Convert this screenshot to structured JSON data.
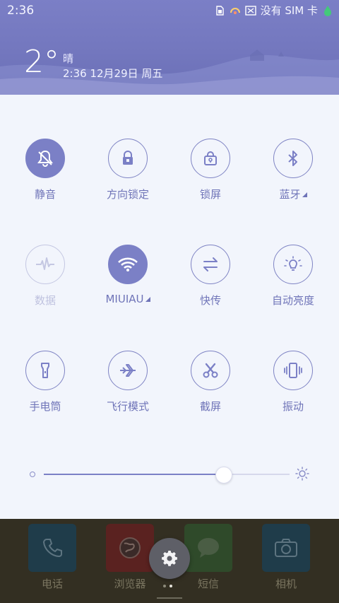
{
  "status_bar": {
    "time": "2:36",
    "carrier": "没有 SIM 卡"
  },
  "weather": {
    "temperature": "2°",
    "condition": "晴",
    "datetime": "2:36 12月29日 周五"
  },
  "toggles": [
    {
      "label": "静音",
      "icon": "mute-icon",
      "state": "active"
    },
    {
      "label": "方向锁定",
      "icon": "lock-icon",
      "state": "off"
    },
    {
      "label": "锁屏",
      "icon": "lock-screen-icon",
      "state": "off"
    },
    {
      "label": "蓝牙",
      "icon": "bluetooth-icon",
      "state": "off",
      "has_menu": true
    },
    {
      "label": "数据",
      "icon": "mobile-data-icon",
      "state": "disabled"
    },
    {
      "label": "MIUIAU",
      "icon": "wifi-icon",
      "state": "active",
      "has_menu": true
    },
    {
      "label": "快传",
      "icon": "transfer-icon",
      "state": "off"
    },
    {
      "label": "自动亮度",
      "icon": "auto-brightness-icon",
      "state": "off"
    },
    {
      "label": "手电筒",
      "icon": "flashlight-icon",
      "state": "off"
    },
    {
      "label": "飞行模式",
      "icon": "airplane-icon",
      "state": "off"
    },
    {
      "label": "截屏",
      "icon": "screenshot-icon",
      "state": "off"
    },
    {
      "label": "振动",
      "icon": "vibrate-icon",
      "state": "off"
    }
  ],
  "brightness": {
    "level": 0.73
  },
  "dock": {
    "apps": [
      {
        "label": "电话",
        "icon": "phone-icon",
        "color": "#1f3c4a"
      },
      {
        "label": "浏览器",
        "icon": "browser-icon",
        "color": "#5a2220"
      },
      {
        "label": "短信",
        "icon": "message-icon",
        "color": "#2f4a2a"
      },
      {
        "label": "相机",
        "icon": "camera-icon",
        "color": "#1f3c4a"
      }
    ]
  },
  "colors": {
    "accent": "#7b80c6",
    "header": "#7377be",
    "panel": "#f2f5fc"
  }
}
